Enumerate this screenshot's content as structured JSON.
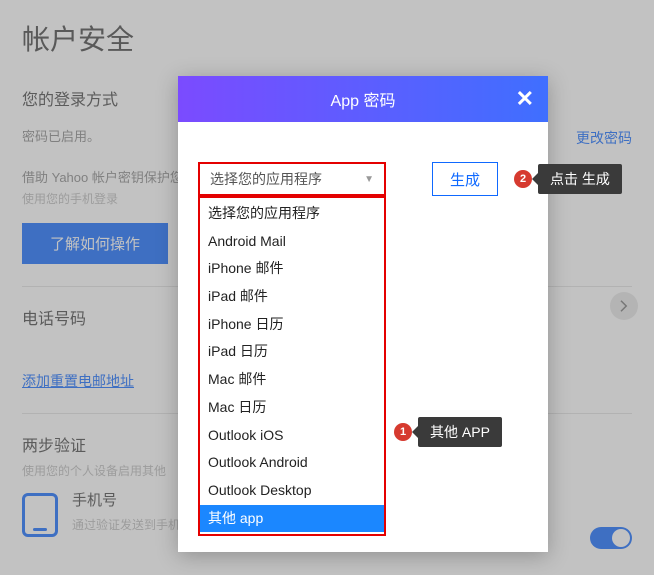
{
  "page": {
    "title": "帐户安全",
    "login_section": {
      "heading": "您的登录方式",
      "status": "密码已启用。",
      "change_link": "更改密码"
    },
    "key_section": {
      "line1": "借助 Yahoo 帐户密钥保护您",
      "line2": "使用您的手机登录",
      "button": "了解如何操作"
    },
    "phone_section": {
      "heading": "电话号码",
      "add_link": "添加重置电邮地址"
    },
    "two_step": {
      "heading": "两步验证",
      "sub": "使用您的个人设备启用其他",
      "phone_label": "手机号",
      "phone_sub": "通过验证发送到手机的代码登录。"
    }
  },
  "modal": {
    "title": "App 密码",
    "select_placeholder": "选择您的应用程序",
    "generate": "生成",
    "options": [
      "选择您的应用程序",
      "Android Mail",
      "iPhone 邮件",
      "iPad 邮件",
      "iPhone 日历",
      "iPad 日历",
      "Mac 邮件",
      "Mac 日历",
      "Outlook iOS",
      "Outlook Android",
      "Outlook Desktop",
      "其他 app"
    ],
    "selected_index": 11
  },
  "annotations": {
    "step1": {
      "num": "1",
      "text": "其他 APP"
    },
    "step2": {
      "num": "2",
      "text": "点击 生成"
    }
  }
}
